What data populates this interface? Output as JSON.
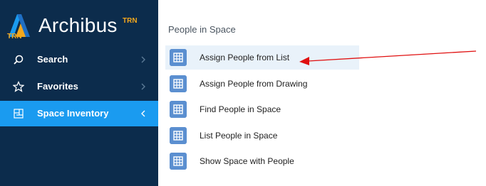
{
  "app": {
    "name": "Archibus",
    "superscript": "TRN",
    "logo_badge": "TRN"
  },
  "sidebar": {
    "items": [
      {
        "label": "Search",
        "icon": "search-icon",
        "expanded": false
      },
      {
        "label": "Favorites",
        "icon": "star-icon",
        "expanded": false
      },
      {
        "label": "Space Inventory",
        "icon": "floor-plan-icon",
        "expanded": true
      }
    ]
  },
  "main": {
    "section_title": "People in Space",
    "tasks": [
      {
        "label": "Assign People from List",
        "selected": true
      },
      {
        "label": "Assign People from Drawing",
        "selected": false
      },
      {
        "label": "Find People in Space",
        "selected": false
      },
      {
        "label": "List People in Space",
        "selected": false
      },
      {
        "label": "Show Space with People",
        "selected": false
      }
    ]
  },
  "colors": {
    "sidebar_bg": "#0c2c4c",
    "active_item_bg": "#1a9bf0",
    "task_icon_bg": "#5b8fd0",
    "selected_row_bg": "#e9f2fa",
    "annotation_arrow": "#e01010",
    "logo_accent": "#f4a81d"
  }
}
